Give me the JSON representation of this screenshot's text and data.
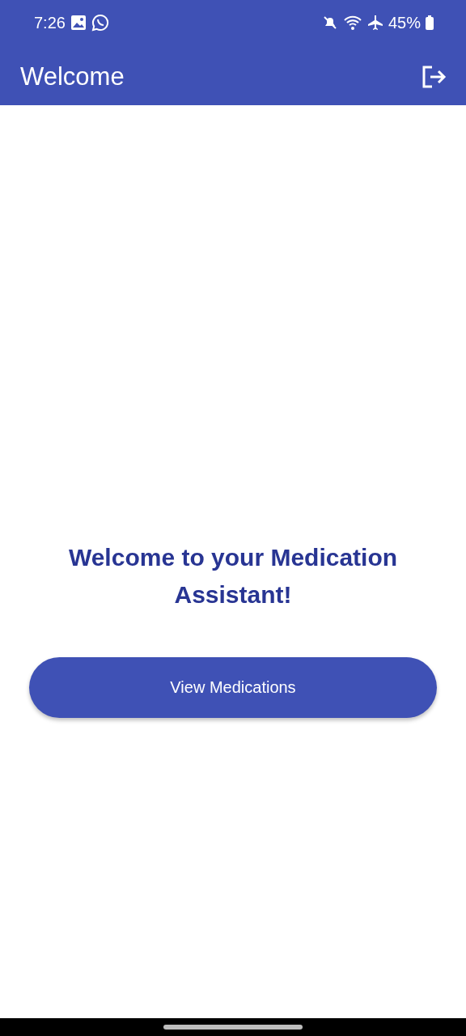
{
  "status_bar": {
    "time": "7:26",
    "battery": "45%"
  },
  "app_bar": {
    "title": "Welcome"
  },
  "heading": "Welcome to your Medication Assistant!",
  "button": "View Medications"
}
